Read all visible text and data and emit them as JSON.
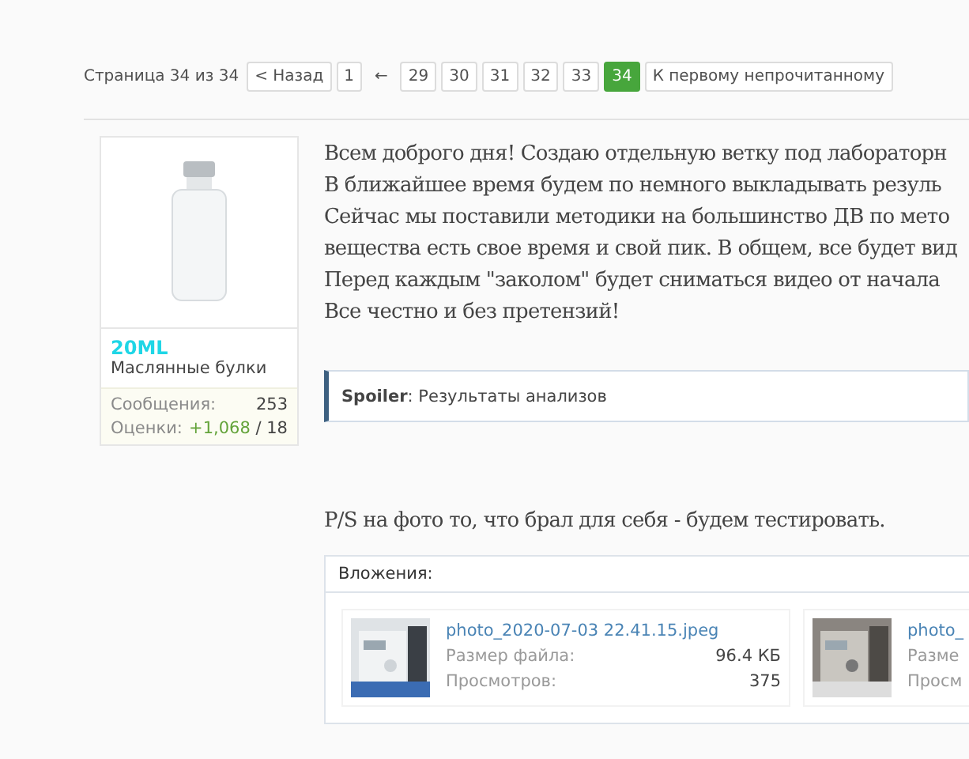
{
  "pagination": {
    "summary": "Страница 34 из 34",
    "pages": [
      {
        "kind": "button",
        "label": "< Назад",
        "selected": false
      },
      {
        "kind": "button",
        "label": "1",
        "selected": false
      },
      {
        "kind": "gap",
        "label": "←"
      },
      {
        "kind": "button",
        "label": "29",
        "selected": false
      },
      {
        "kind": "button",
        "label": "30",
        "selected": false
      },
      {
        "kind": "button",
        "label": "31",
        "selected": false
      },
      {
        "kind": "button",
        "label": "32",
        "selected": false
      },
      {
        "kind": "button",
        "label": "33",
        "selected": false
      },
      {
        "kind": "button",
        "label": "34",
        "selected": true
      },
      {
        "kind": "button",
        "label": "К первому непрочитанному",
        "selected": false
      }
    ]
  },
  "author": {
    "username": "20ML",
    "title": "Маслянные булки",
    "stats": [
      {
        "label": "Сообщения:",
        "value": "253"
      },
      {
        "label": "Оценки:",
        "value": "+1,068",
        "extra": "/ 18"
      }
    ]
  },
  "post": {
    "lines": [
      "Всем доброго дня! Создаю отдельную ветку под лабораторн",
      "В ближайшее время будем по немного выкладывать резуль",
      "Сейчас мы поставили методики на большинство ДВ по мето",
      "вещества есть свое время и свой пик. В общем, все будет вид",
      "Перед каждым \"заколом\" будет сниматься видео от начала",
      "Все честно и без претензий!"
    ],
    "spoiler": "**Spoiler**: Результаты анализов",
    "ps": "P/S на фото то, что брал для себя - будем тестировать."
  },
  "attachments": {
    "title": "Вложения:",
    "items": [
      {
        "name": "photo_2020-07-03 22.41.15.jpeg",
        "size_label": "Размер файла:",
        "size": "96.4 КБ",
        "views_label": "Просмотров:",
        "views": "375"
      },
      {
        "name": "photo_",
        "size_label": "Разме",
        "views_label": "Просм"
      }
    ]
  }
}
